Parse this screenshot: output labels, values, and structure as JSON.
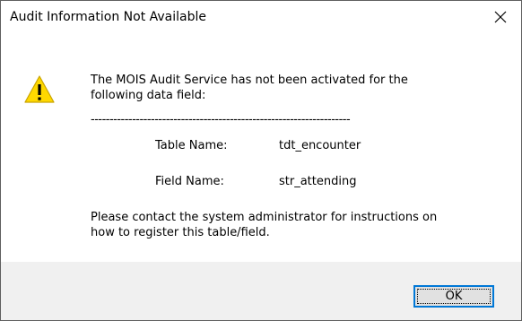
{
  "dialog": {
    "title": "Audit Information Not Available",
    "close_icon": "close-icon",
    "warning_icon": "warning-icon",
    "message_line1": "The MOIS Audit Service has not been activated for the",
    "message_line2": "following data field:",
    "separator": "---------------------------------------------------------------------",
    "fields": [
      {
        "label": "Table Name:",
        "value": "tdt_encounter"
      },
      {
        "label": "Field Name:",
        "value": "str_attending"
      }
    ],
    "footer_line1": "Please contact the system administrator for instructions on",
    "footer_line2": "how to register this table/field.",
    "ok_label": "OK"
  },
  "colors": {
    "accent": "#0078d7",
    "warning_fill": "#ffd800",
    "footer_bg": "#f0f0f0"
  }
}
